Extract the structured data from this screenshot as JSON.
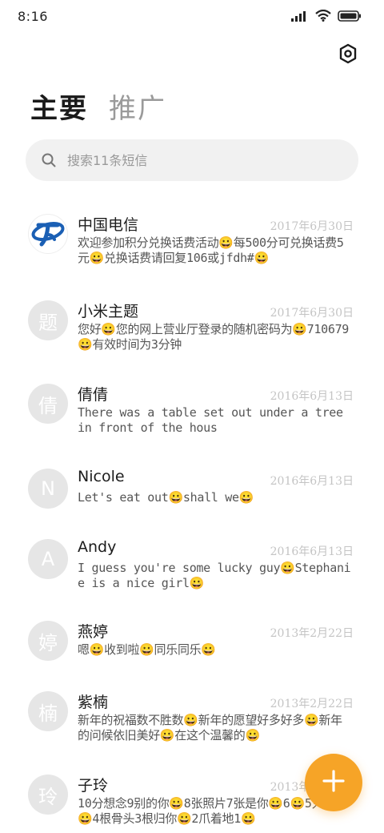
{
  "status_bar": {
    "time": "8:16",
    "icons": [
      "signal-icon",
      "wifi-icon",
      "battery-icon"
    ]
  },
  "header": {
    "settings_icon": "gear-icon"
  },
  "tabs": [
    {
      "label": "主要",
      "active": true
    },
    {
      "label": "推广",
      "active": false
    }
  ],
  "search": {
    "placeholder": "搜索11条短信"
  },
  "messages": [
    {
      "avatar": "",
      "avatar_icon": "china-telecom-logo",
      "name": "中国电信",
      "date": "2017年6月30日",
      "preview": "欢迎参加积分兑换话费活动😀每500分可兑换话费5元😀兑换话费请回复106或jfdh#😀"
    },
    {
      "avatar": "题",
      "name": "小米主题",
      "date": "2017年6月30日",
      "preview": "您好😀您的网上营业厅登录的随机密码为😀710679😀有效时间为3分钟"
    },
    {
      "avatar": "倩",
      "name": "倩倩",
      "date": "2016年6月13日",
      "preview": "There was a table set out under a tree in front of the hous"
    },
    {
      "avatar": "N",
      "name": "Nicole",
      "date": "2016年6月13日",
      "preview": "Let's eat out😀shall we😀"
    },
    {
      "avatar": "A",
      "name": "Andy",
      "date": "2016年6月13日",
      "preview": "I guess you're some lucky guy😀Stephanie is a nice girl😀"
    },
    {
      "avatar": "婷",
      "name": "燕婷",
      "date": "2013年2月22日",
      "preview": "嗯😀收到啦😀同乐同乐😀"
    },
    {
      "avatar": "楠",
      "name": "紫楠",
      "date": "2013年2月22日",
      "preview": "新年的祝福数不胜数😀新年的愿望好多好多😀新年的问候依旧美好😀在这个温馨的😀"
    },
    {
      "avatar": "玲",
      "name": "子玲",
      "date": "2013年2月22日",
      "preview": "10分想念9别的你😀8张照片7张是你😀6😀5只像你😀4根骨头3根归你😀2爪着地1😀"
    }
  ],
  "fab": {
    "icon": "plus-icon",
    "color": "#f6a427"
  },
  "colors": {
    "accent": "#f6a427",
    "avatar_bg": "#e6e6e6",
    "date_text": "#c4c4c4",
    "telecom_blue": "#1a5fb4"
  }
}
